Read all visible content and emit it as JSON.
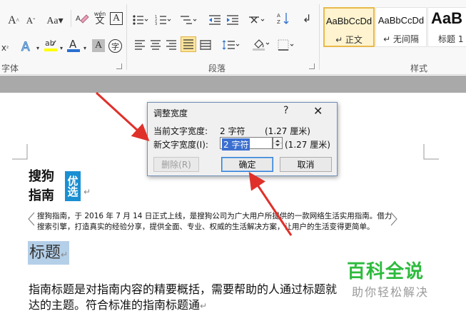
{
  "ribbon": {
    "font_group": {
      "label": "字体",
      "buttons": [
        "A",
        "A",
        "Aa",
        "wén",
        "A",
        "×",
        "A",
        "ab",
        "A",
        "A",
        "字"
      ],
      "grow_font": "A˄",
      "shrink_font": "A˅",
      "change_case": "Aa▾",
      "phonetic_guide": "文",
      "char_border": "A"
    },
    "paragraph_group": {
      "label": "段落"
    },
    "styles_group": {
      "label": "样式",
      "styles": [
        {
          "sample": "AaBbCcDd",
          "name": "↵ 正文"
        },
        {
          "sample": "AaBbCcDd",
          "name": "↵ 无间隔"
        },
        {
          "sample": "AaB",
          "name": "标题 1"
        }
      ]
    }
  },
  "dialog": {
    "title": "调整宽度",
    "help": "?",
    "close": "✕",
    "current_label": "当前文字宽度:",
    "current_value": "2 字符",
    "current_cm": "(1.27 厘米)",
    "new_label": "新文字宽度(I):",
    "new_value": "2 字符",
    "new_cm": "(1.27 厘米)",
    "delete_btn": "删除(R)",
    "ok_btn": "确定",
    "cancel_btn": "取消"
  },
  "document": {
    "logo_line1": "搜狗",
    "logo_line2": "指南",
    "logo_vertical": "优选",
    "para_mark": "↵",
    "intro": "搜狗指南，于 2016 年 7 月 14 日正式上线，是搜狗公司为广大用户所提供的一款网络生活实用指南。借力搜索引擎，打造真实的经验分享，提供全面、专业、权威的生活解决方案，让用户的生活变得更简单。",
    "heading": "标题",
    "body_line1": "指南标题是对指南内容的精要概括，需要帮助的人通过标题就",
    "body_line2": "达的主题。符合标准的指南标题通"
  },
  "watermark": {
    "title": "百科全说",
    "subtitle": "助你轻松解决"
  },
  "colors": {
    "accent_arrow": "#e0302a",
    "selection": "#b4cfe8",
    "watermark_green": "#2dbb3d",
    "style_active_border": "#e8b94a"
  }
}
